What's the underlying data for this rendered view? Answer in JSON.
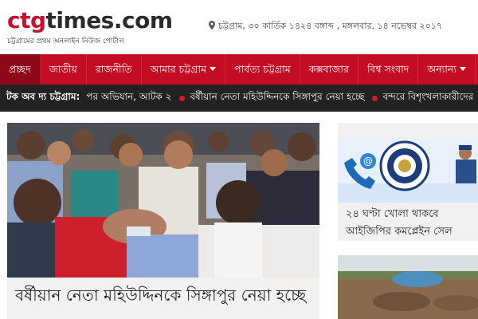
{
  "site": {
    "logo_primary": "ctg",
    "logo_secondary": "times.com",
    "tagline": "চট্টগ্রামের প্রথম অনলাইন নিউজ পোর্টাল",
    "dateline": "চট্টগ্রাম, ৩০ কার্তিক ১৪২৪ বঙ্গাব্দ , মঙ্গলবার, ১৪ নভেম্বর ২০১৭"
  },
  "nav": {
    "items": [
      {
        "label": "প্রচ্ছদ"
      },
      {
        "label": "জাতীয়"
      },
      {
        "label": "রাজনীতি"
      },
      {
        "label": "আমার চট্টগ্রাম"
      },
      {
        "label": "পার্বত্য চট্টগ্রাম"
      },
      {
        "label": "কক্সবাজার"
      },
      {
        "label": "বিশ্ব সংবাদ"
      },
      {
        "label": "অন্যান্য"
      }
    ]
  },
  "ticker": {
    "label": "টক অব দ্য চট্টগ্রাম:",
    "items": [
      "পর অভিযান, আটক ২",
      "বর্ষীয়ান নেতা মহিউদ্দিনকে সিঙ্গাপুর নেয়া হচ্ছে",
      "বন্দরে বিশৃংখলাকারীদের"
    ]
  },
  "lead": {
    "headline": "বর্ষীয়ান নেতা মহিউদ্দিনকে সিঙ্গাপুর নেয়া হচ্ছে"
  },
  "sidebar": {
    "card1_title": "২৪ ঘণ্টা খোলা থাকবে আইজিপির কমপ্লেইন সেল"
  },
  "colors": {
    "brand_red": "#c40d24",
    "nav_active": "#8e0a1a",
    "ticker_bg": "#222222"
  },
  "icons": {
    "dateline_icon": "map-pin-icon",
    "ticker_bullet": "red-dot-icon",
    "nav_dropdown": "caret-down-icon"
  }
}
